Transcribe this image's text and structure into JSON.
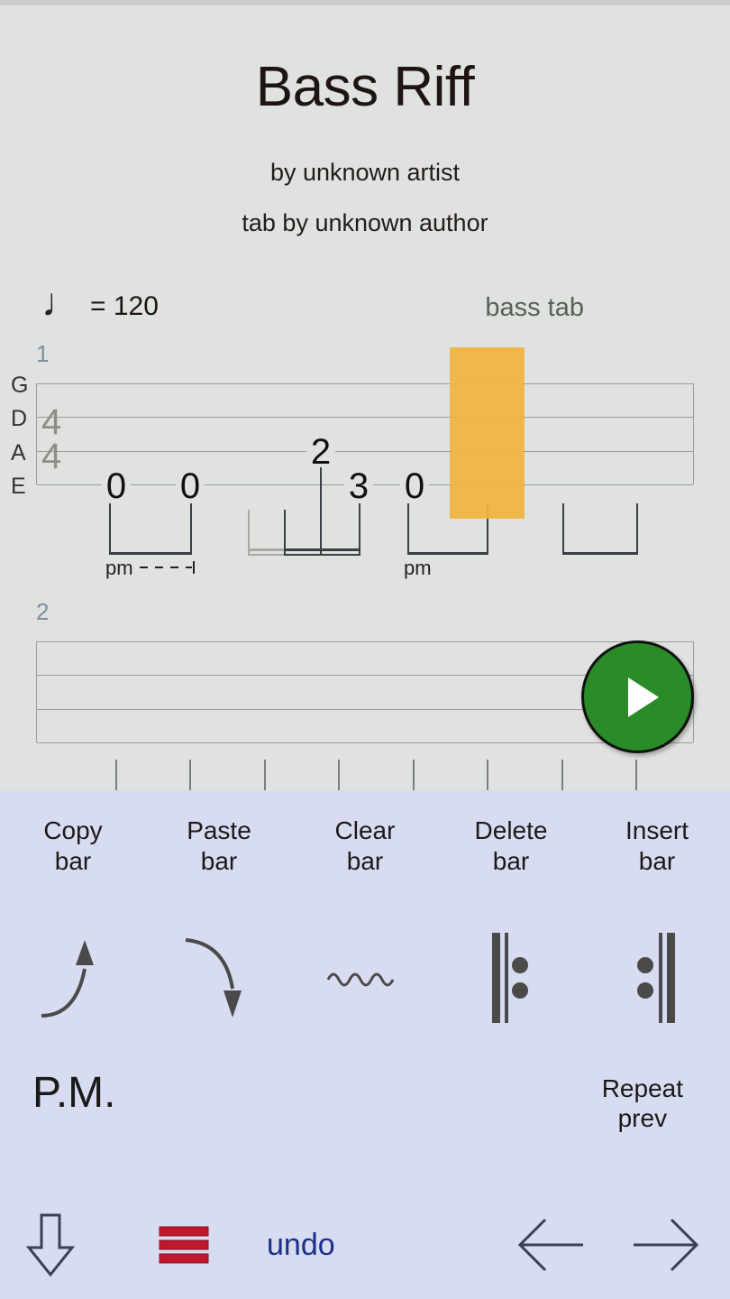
{
  "song": {
    "title": "Bass Riff",
    "artist": "by unknown artist",
    "tabber": "tab by unknown author"
  },
  "tempo": {
    "note_icon": "♩",
    "equals_value": "= 120",
    "bpm": 120
  },
  "instrument_label": "bass tab",
  "staff": {
    "string_labels": [
      "G",
      "D",
      "A",
      "E"
    ],
    "time_signature": {
      "top": "4",
      "bottom": "4"
    },
    "bars": [
      {
        "number": "1",
        "notes": [
          {
            "fret": "0",
            "string": "E"
          },
          {
            "fret": "0",
            "string": "E"
          },
          {
            "fret": "2",
            "string": "A"
          },
          {
            "fret": "3",
            "string": "E"
          },
          {
            "fret": "0",
            "string": "E"
          }
        ],
        "palm_mute_marks": [
          "pm",
          "pm"
        ]
      },
      {
        "number": "2",
        "notes": [],
        "palm_mute_marks": []
      }
    ]
  },
  "cursor": {
    "visible": true,
    "color": "#f2b33d"
  },
  "play_button": {
    "label": "play",
    "color": "#2a8c28"
  },
  "toolbar": {
    "commands": [
      {
        "line1": "Copy",
        "line2": "bar"
      },
      {
        "line1": "Paste",
        "line2": "bar"
      },
      {
        "line1": "Clear",
        "line2": "bar"
      },
      {
        "line1": "Delete",
        "line2": "bar"
      },
      {
        "line1": "Insert",
        "line2": "bar"
      }
    ],
    "icons": [
      {
        "name": "bend-up-icon"
      },
      {
        "name": "bend-down-icon"
      },
      {
        "name": "vibrato-icon"
      },
      {
        "name": "repeat-start-icon"
      },
      {
        "name": "repeat-end-icon"
      }
    ],
    "palm_mute_label": "P.M.",
    "repeat_prev": {
      "line1": "Repeat",
      "line2": "prev"
    }
  },
  "nav": {
    "down_arrow": "↓",
    "menu_icon": "menu-icon",
    "undo_label": "undo",
    "left_arrow": "←",
    "right_arrow": "→",
    "menu_color": "#c0172c"
  }
}
